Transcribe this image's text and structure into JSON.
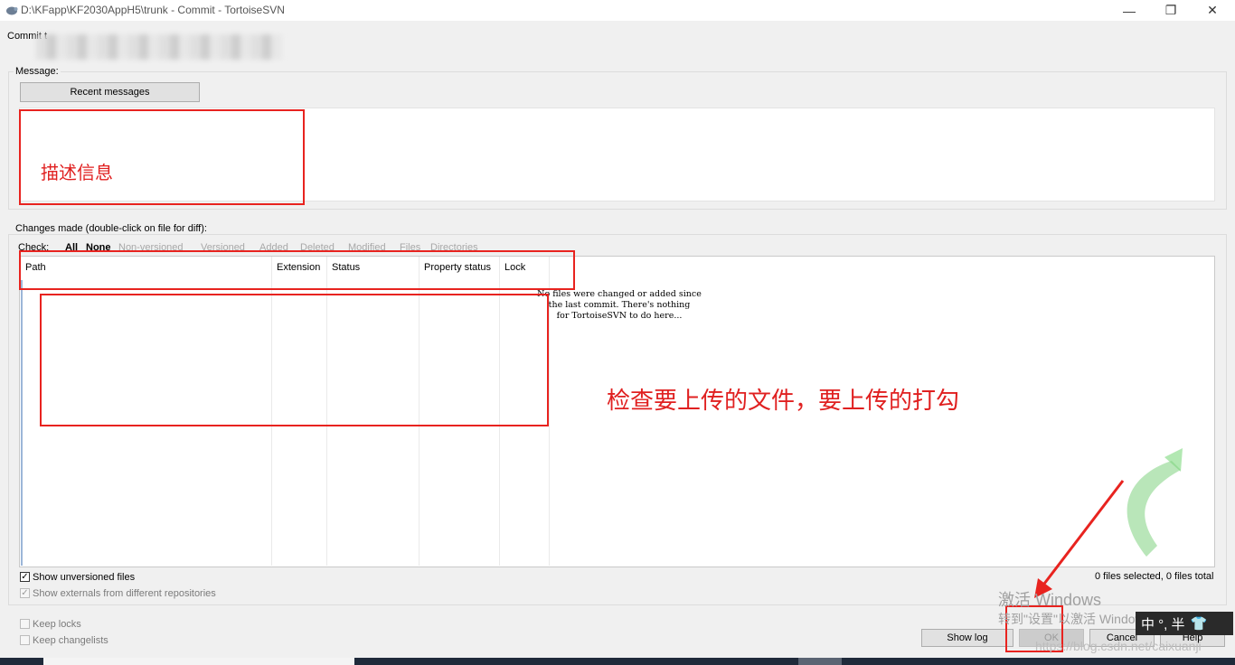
{
  "window": {
    "title": "D:\\KFapp\\KF2030AppH5\\trunk - Commit - TortoiseSVN",
    "minimize_glyph": "—",
    "restore_glyph": "❐",
    "close_glyph": "✕"
  },
  "commit_to": {
    "label": "Commit t"
  },
  "message": {
    "group_label": "Message:",
    "recent_button": "Recent messages",
    "annotation": "描述信息"
  },
  "changes": {
    "group_label": "Changes made (double-click on file for diff):",
    "check_label": "Check:",
    "filters": [
      "All",
      "None",
      "Non-versioned",
      "Versioned",
      "Added",
      "Deleted",
      "Modified",
      "Files",
      "Directories"
    ],
    "columns": [
      "Path",
      "Extension",
      "Status",
      "Property status",
      "Lock"
    ],
    "empty_message": "No files were changed or added since\nthe last commit. There's nothing\nfor TortoiseSVN to do here...",
    "annotation": "检查要上传的文件，要上传的打勾",
    "files_count": "0 files selected, 0 files total"
  },
  "options": {
    "show_unversioned": {
      "label": "Show unversioned files",
      "checked": true
    },
    "show_externals": {
      "label": "Show externals from different repositories",
      "checked": true,
      "disabled": true
    },
    "keep_locks": {
      "label": "Keep locks",
      "checked": false
    },
    "keep_changelists": {
      "label": "Keep changelists",
      "checked": false
    }
  },
  "buttons": {
    "show_log": "Show log",
    "ok": "OK",
    "cancel": "Cancel",
    "help": "Help"
  },
  "overlay": {
    "activate_title": "激活 Windows",
    "activate_sub": "转到\"设置\"以激活 Windows。",
    "watermark": "https://blog.csdn.net/caixuanji",
    "ime_text": "中 °, 半"
  },
  "colors": {
    "annotation_red": "#e8231f",
    "arrow_green": "#7fd17f"
  }
}
